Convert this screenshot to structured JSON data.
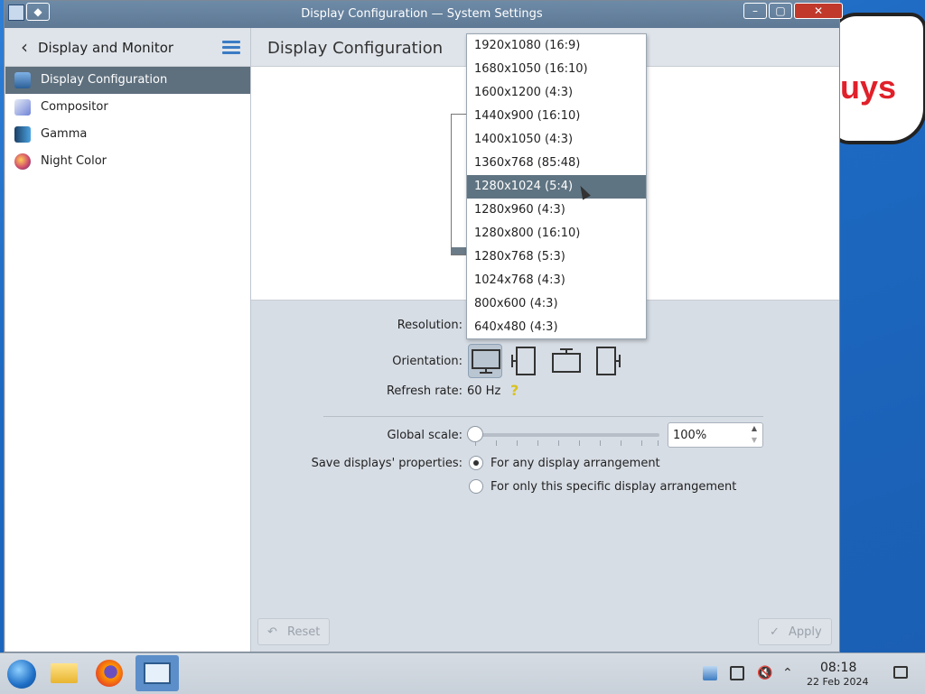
{
  "window": {
    "title": "Display Configuration — System Settings"
  },
  "sidebar": {
    "header_title": "Display and Monitor",
    "items": [
      {
        "label": "Display Configuration",
        "selected": true
      },
      {
        "label": "Compositor",
        "selected": false
      },
      {
        "label": "Gamma",
        "selected": false
      },
      {
        "label": "Night Color",
        "selected": false
      }
    ]
  },
  "main": {
    "title": "Display Configuration",
    "resolution_label": "Resolution:",
    "orientation_label": "Orientation:",
    "refresh_label": "Refresh rate:",
    "refresh_value": "60 Hz",
    "global_scale_label": "Global scale:",
    "global_scale_value": "100%",
    "save_label": "Save displays' properties:",
    "save_options": [
      {
        "label": "For any display arrangement",
        "checked": true
      },
      {
        "label": "For only this specific display arrangement",
        "checked": false
      }
    ],
    "reset_label": "Reset",
    "apply_label": "Apply"
  },
  "dropdown": {
    "options": [
      "1920x1080 (16:9)",
      "1680x1050 (16:10)",
      "1600x1200 (4:3)",
      "1440x900 (16:10)",
      "1400x1050 (4:3)",
      "1360x768 (85:48)",
      "1280x1024 (5:4)",
      "1280x960 (4:3)",
      "1280x800 (16:10)",
      "1280x768 (5:3)",
      "1024x768 (4:3)",
      "800x600 (4:3)",
      "640x480 (4:3)"
    ],
    "highlighted_index": 6
  },
  "desktop": {
    "bubble_text": "uys"
  },
  "taskbar": {
    "time": "08:18",
    "date": "22 Feb 2024"
  },
  "colors": {
    "selection": "#5e6f7d",
    "titlebar": "#6d8aa7",
    "desktop": "#1d69c2"
  }
}
